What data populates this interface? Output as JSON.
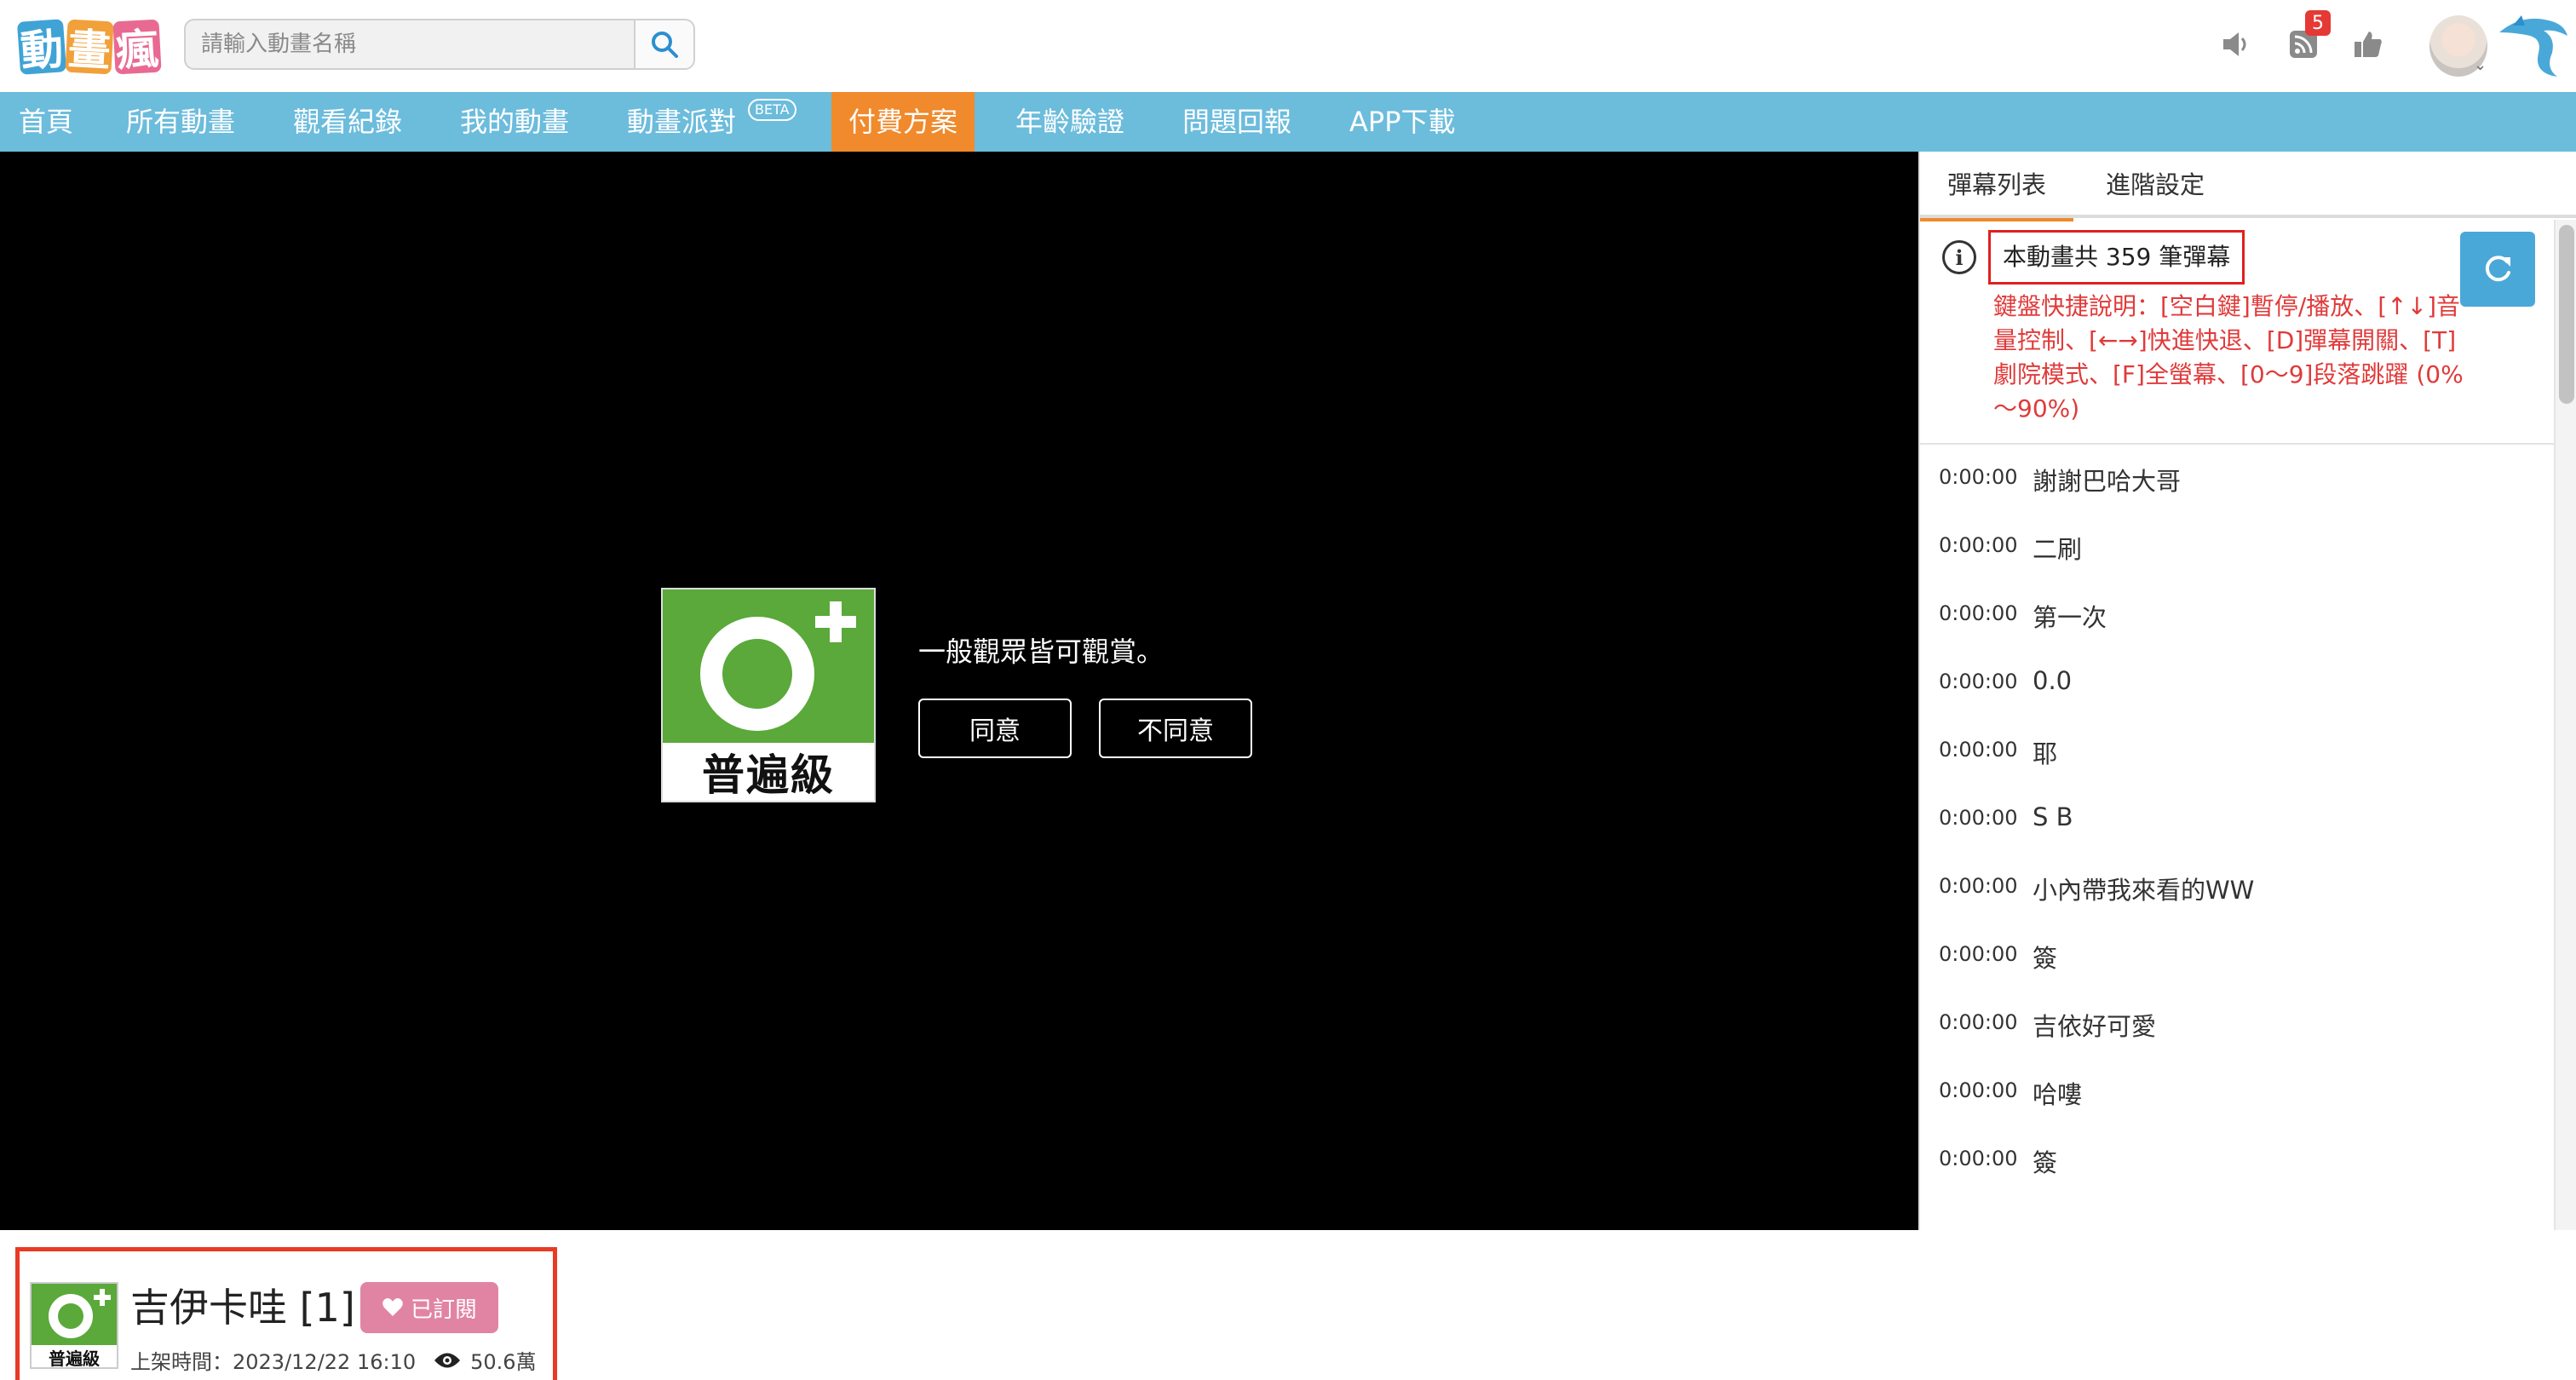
{
  "header": {
    "logo_chars": [
      "動",
      "畫",
      "瘋"
    ],
    "search_placeholder": "請輸入動畫名稱",
    "notification_count": "5"
  },
  "nav": {
    "items": [
      {
        "label": "首頁"
      },
      {
        "label": "所有動畫"
      },
      {
        "label": "觀看紀錄"
      },
      {
        "label": "我的動畫"
      },
      {
        "label": "動畫派對",
        "badge": "BETA"
      },
      {
        "label": "付費方案",
        "active": true
      },
      {
        "label": "年齡驗證"
      },
      {
        "label": "問題回報"
      },
      {
        "label": "APP下載"
      }
    ]
  },
  "player": {
    "rating_label": "普遍級",
    "rating_message": "一般觀眾皆可觀賞。",
    "agree_label": "同意",
    "disagree_label": "不同意"
  },
  "panel": {
    "tabs": [
      "彈幕列表",
      "進階設定"
    ],
    "count_text": "本動畫共 359 筆彈幕",
    "hint": "鍵盤快捷說明：[空白鍵]暫停/播放、[↑↓]音量控制、[←→]快進快退、[D]彈幕開關、[T]劇院模式、[F]全螢幕、[0～9]段落跳躍 (0%～90%)",
    "danmaku": [
      {
        "time": "0:00:00",
        "text": "謝謝巴哈大哥"
      },
      {
        "time": "0:00:00",
        "text": "二刷"
      },
      {
        "time": "0:00:00",
        "text": "第一次"
      },
      {
        "time": "0:00:00",
        "text": "0.0"
      },
      {
        "time": "0:00:00",
        "text": "耶"
      },
      {
        "time": "0:00:00",
        "text": "S B"
      },
      {
        "time": "0:00:00",
        "text": "小內帶我來看的WW"
      },
      {
        "time": "0:00:00",
        "text": "簽"
      },
      {
        "time": "0:00:00",
        "text": "吉依好可愛"
      },
      {
        "time": "0:00:00",
        "text": "哈嘍"
      },
      {
        "time": "0:00:00",
        "text": "簽"
      }
    ]
  },
  "video": {
    "rating_label": "普遍級",
    "title": "吉伊卡哇 [1]",
    "subscribe_label": "已訂閱",
    "upload_label": "上架時間：2023/12/22 16:10",
    "views": "50.6萬"
  },
  "colors": {
    "nav_bg": "#6cbcdc",
    "nav_active": "#f08a2c",
    "rating_green": "#5aa93a",
    "highlight_red": "#e02020",
    "hint_red": "#e03a3a",
    "subscribe_pink": "#e184a4",
    "refresh_blue": "#4aa8d8"
  }
}
